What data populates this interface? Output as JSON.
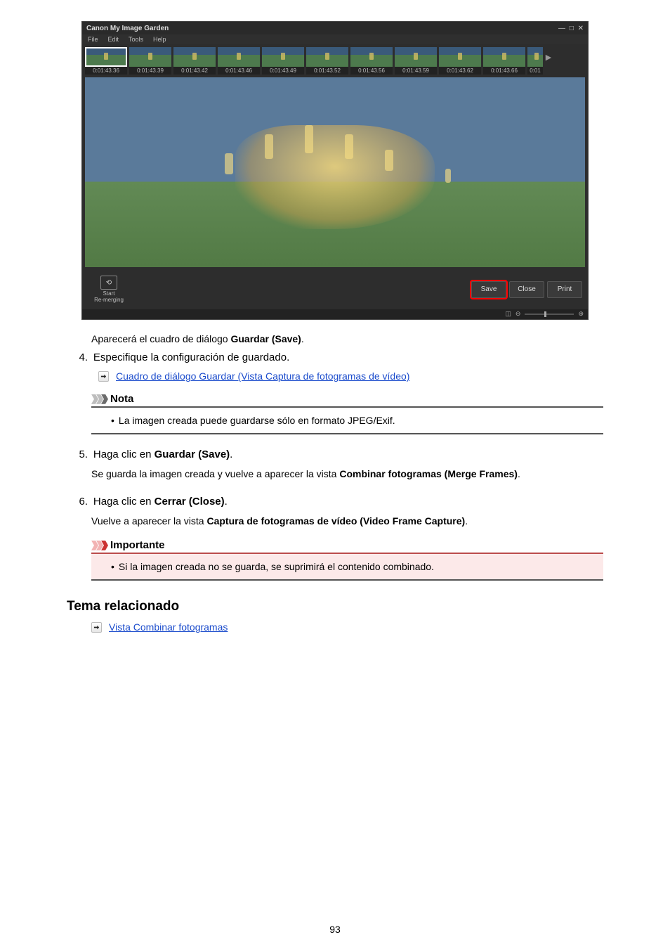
{
  "app": {
    "title": "Canon My Image Garden",
    "menus": [
      "File",
      "Edit",
      "Tools",
      "Help"
    ],
    "thumbs": [
      "0:01:43.36",
      "0:01:43.39",
      "0:01:43.42",
      "0:01:43.46",
      "0:01:43.49",
      "0:01:43.52",
      "0:01:43.56",
      "0:01:43.59",
      "0:01:43.62",
      "0:01:43.66",
      "0:01"
    ],
    "remerge_label": "Start\nRe-merging",
    "buttons": {
      "save": "Save",
      "close": "Close",
      "print": "Print"
    }
  },
  "dialog_text": {
    "pre": "Aparecerá el cuadro de diálogo ",
    "bold": "Guardar (Save)",
    "post": "."
  },
  "steps": {
    "s4": {
      "num": "4.",
      "text": "Especifique la configuración de guardado.",
      "link": "Cuadro de diálogo Guardar (Vista Captura de fotogramas de vídeo)",
      "note_title": "Nota",
      "note_body": "La imagen creada puede guardarse sólo en formato JPEG/Exif."
    },
    "s5": {
      "num": "5.",
      "pre": "Haga clic en ",
      "bold": "Guardar (Save)",
      "post": ".",
      "body_pre": "Se guarda la imagen creada y vuelve a aparecer la vista ",
      "body_bold": "Combinar fotogramas (Merge Frames)",
      "body_post": "."
    },
    "s6": {
      "num": "6.",
      "pre": "Haga clic en ",
      "bold": "Cerrar (Close)",
      "post": ".",
      "body_pre": "Vuelve a aparecer la vista ",
      "body_bold": "Captura de fotogramas de vídeo (Video Frame Capture)",
      "body_post": ".",
      "imp_title": "Importante",
      "imp_body": "Si la imagen creada no se guarda, se suprimirá el contenido combinado."
    }
  },
  "related": {
    "heading": "Tema relacionado",
    "link": "Vista Combinar fotogramas"
  },
  "page_number": "93"
}
